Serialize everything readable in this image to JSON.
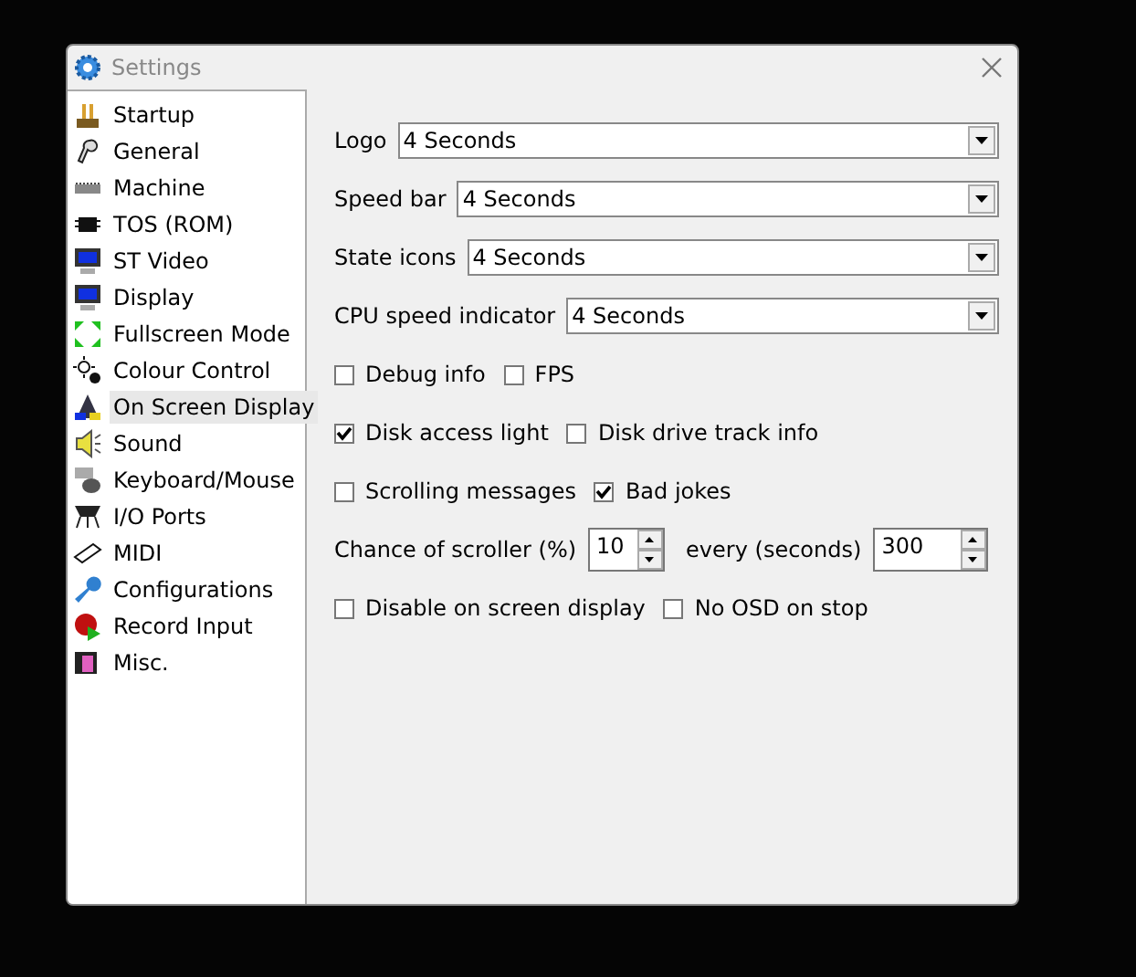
{
  "window": {
    "title": "Settings"
  },
  "sidebar": {
    "items": [
      {
        "label": "Startup",
        "selected": false
      },
      {
        "label": "General",
        "selected": false
      },
      {
        "label": "Machine",
        "selected": false
      },
      {
        "label": "TOS (ROM)",
        "selected": false
      },
      {
        "label": "ST Video",
        "selected": false
      },
      {
        "label": "Display",
        "selected": false
      },
      {
        "label": "Fullscreen Mode",
        "selected": false
      },
      {
        "label": "Colour Control",
        "selected": false
      },
      {
        "label": "On Screen Display",
        "selected": true
      },
      {
        "label": "Sound",
        "selected": false
      },
      {
        "label": "Keyboard/Mouse",
        "selected": false
      },
      {
        "label": "I/O Ports",
        "selected": false
      },
      {
        "label": "MIDI",
        "selected": false
      },
      {
        "label": "Configurations",
        "selected": false
      },
      {
        "label": "Record Input",
        "selected": false
      },
      {
        "label": "Misc.",
        "selected": false
      }
    ]
  },
  "rows": [
    {
      "kind": "select",
      "label": "Logo",
      "value": "4 Seconds"
    },
    {
      "kind": "select",
      "label": "Speed bar",
      "value": "4 Seconds"
    },
    {
      "kind": "select",
      "label": "State icons",
      "value": "4 Seconds"
    },
    {
      "kind": "select",
      "label": "CPU speed indicator",
      "value": "4 Seconds"
    },
    {
      "kind": "checks",
      "items": [
        {
          "label": "Debug info",
          "checked": false
        },
        {
          "label": "FPS",
          "checked": false
        }
      ]
    },
    {
      "kind": "checks",
      "items": [
        {
          "label": "Disk access light",
          "checked": true
        },
        {
          "label": "Disk drive track info",
          "checked": false
        }
      ]
    },
    {
      "kind": "checks",
      "items": [
        {
          "label": "Scrolling messages",
          "checked": false
        },
        {
          "label": "Bad jokes",
          "checked": true
        }
      ]
    },
    {
      "kind": "spins",
      "items": [
        {
          "label": "Chance of scroller (%)",
          "value": "10"
        },
        {
          "label": "every (seconds)",
          "value": "300"
        }
      ]
    },
    {
      "kind": "checks",
      "items": [
        {
          "label": "Disable on screen display",
          "checked": false
        },
        {
          "label": "No OSD on stop",
          "checked": false
        }
      ]
    }
  ]
}
